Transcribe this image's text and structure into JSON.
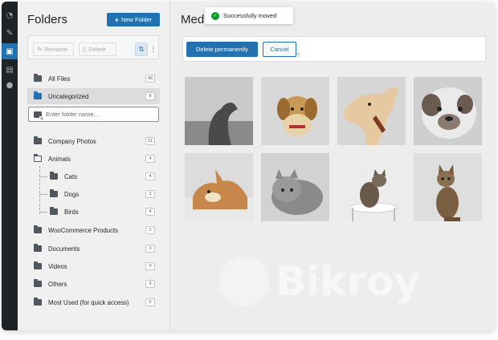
{
  "sidebar_panel": {
    "title": "Folders",
    "new_folder_label": "New Folder",
    "toolbar": {
      "rename_label": "Rename",
      "delete_label": "Delete"
    },
    "top_items": [
      {
        "label": "All Files",
        "count": "46",
        "icon": "folder-icon"
      },
      {
        "label": "Uncategorized",
        "count": "8",
        "icon": "folder-icon",
        "selected": true
      }
    ],
    "search": {
      "placeholder": "Enter folder name..."
    },
    "folders": [
      {
        "label": "Company Photos",
        "count": "11"
      },
      {
        "label": "Animals",
        "count": "4"
      },
      {
        "label": "Cats",
        "count": "4"
      },
      {
        "label": "Dogs",
        "count": "3"
      },
      {
        "label": "Birds",
        "count": "4"
      },
      {
        "label": "WooCommerce Products",
        "count": "2"
      },
      {
        "label": "Documents",
        "count": "0"
      },
      {
        "label": "Videos",
        "count": "0"
      },
      {
        "label": "Others",
        "count": "0"
      },
      {
        "label": "Most Used (for quick access)",
        "count": "0"
      }
    ]
  },
  "main": {
    "title": "Medi",
    "toast": "Successfully moved",
    "delete_permanently_label": "Delete permanently",
    "cancel_label": "Cancel",
    "watermark": "Bikroy"
  },
  "colors": {
    "accent": "#2271b1",
    "success": "#00a32a",
    "admin_bar": "#1d2327"
  }
}
